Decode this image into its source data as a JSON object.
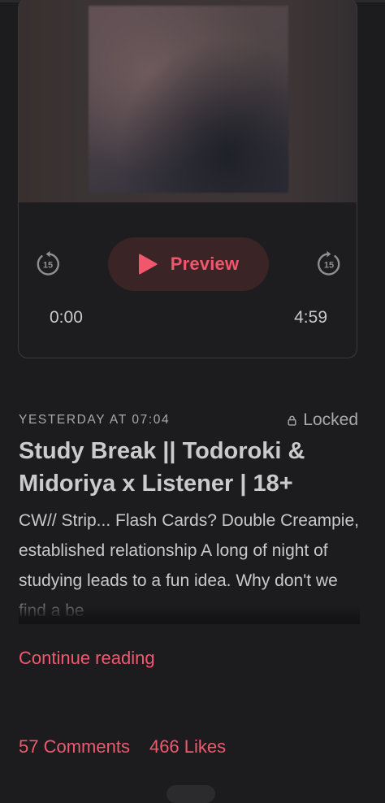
{
  "player": {
    "preview_label": "Preview",
    "skip_back_seconds": "15",
    "skip_forward_seconds": "15",
    "time_current": "0:00",
    "time_total": "4:59",
    "icons": {
      "skip_back": "rewind-15-icon",
      "skip_forward": "forward-15-icon",
      "play": "play-icon"
    },
    "accent_color": "#f0566c"
  },
  "post": {
    "date": "YESTERDAY AT 07:04",
    "locked_label": "Locked",
    "lock_icon": "lock-icon",
    "title": "Study Break || Todoroki & Midoriya x Listener | 18+",
    "excerpt": "CW// Strip... Flash Cards? Double Creampie, established relationship A long of night of studying leads to a fun idea. Why don't we find a be",
    "continue_label": "Continue reading",
    "comments_label": "57 Comments",
    "likes_label": "466 Likes",
    "link_color": "#ee5a6f"
  }
}
